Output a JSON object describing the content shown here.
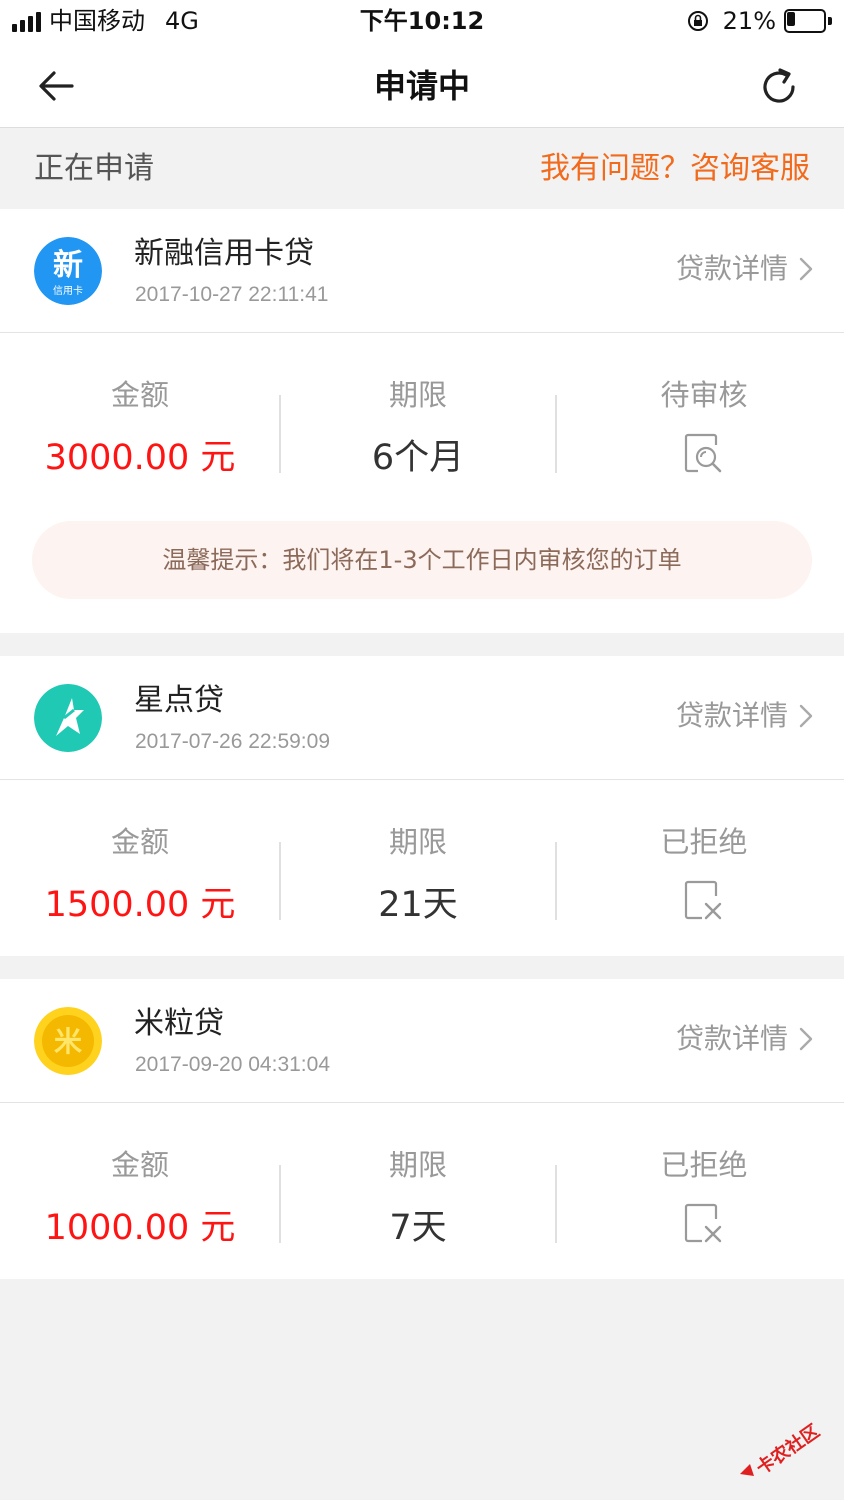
{
  "status_bar": {
    "carrier": "中国移动",
    "network": "4G",
    "time": "下午10:12",
    "battery": "21%",
    "battery_level": 0.21
  },
  "nav": {
    "title": "申请中",
    "back_icon": "arrow-left-icon",
    "refresh_icon": "refresh-icon"
  },
  "section": {
    "title": "正在申请",
    "help_link": "我有问题？咨询客服"
  },
  "colors": {
    "accent_orange": "#f26a1b",
    "amount_red": "#ff1414",
    "xin_blue": "#2196f3",
    "star_teal": "#1fc9b4",
    "mi_yellow": "#ffd21e"
  },
  "loans": [
    {
      "name": "新融信用卡贷",
      "logo_text": "新",
      "logo_sub": "信用卡",
      "time": "2017-10-27 22:11:41",
      "detail_label": "贷款详情",
      "amount_label": "金额",
      "amount": "3000.00 元",
      "term_label": "期限",
      "term": "6个月",
      "status": "待审核",
      "status_icon": "review-search-icon",
      "tip": "温馨提示：我们将在1-3个工作日内审核您的订单"
    },
    {
      "name": "星点贷",
      "time": "2017-07-26 22:59:09",
      "detail_label": "贷款详情",
      "amount_label": "金额",
      "amount": "1500.00 元",
      "term_label": "期限",
      "term": "21天",
      "status": "已拒绝",
      "status_icon": "rejected-x-icon"
    },
    {
      "name": "米粒贷",
      "logo_text": "米",
      "time": "2017-09-20 04:31:04",
      "detail_label": "贷款详情",
      "amount_label": "金额",
      "amount": "1000.00 元",
      "term_label": "期限",
      "term": "7天",
      "status": "已拒绝",
      "status_icon": "rejected-x-icon"
    }
  ],
  "watermark": {
    "text": "卡农社区"
  }
}
